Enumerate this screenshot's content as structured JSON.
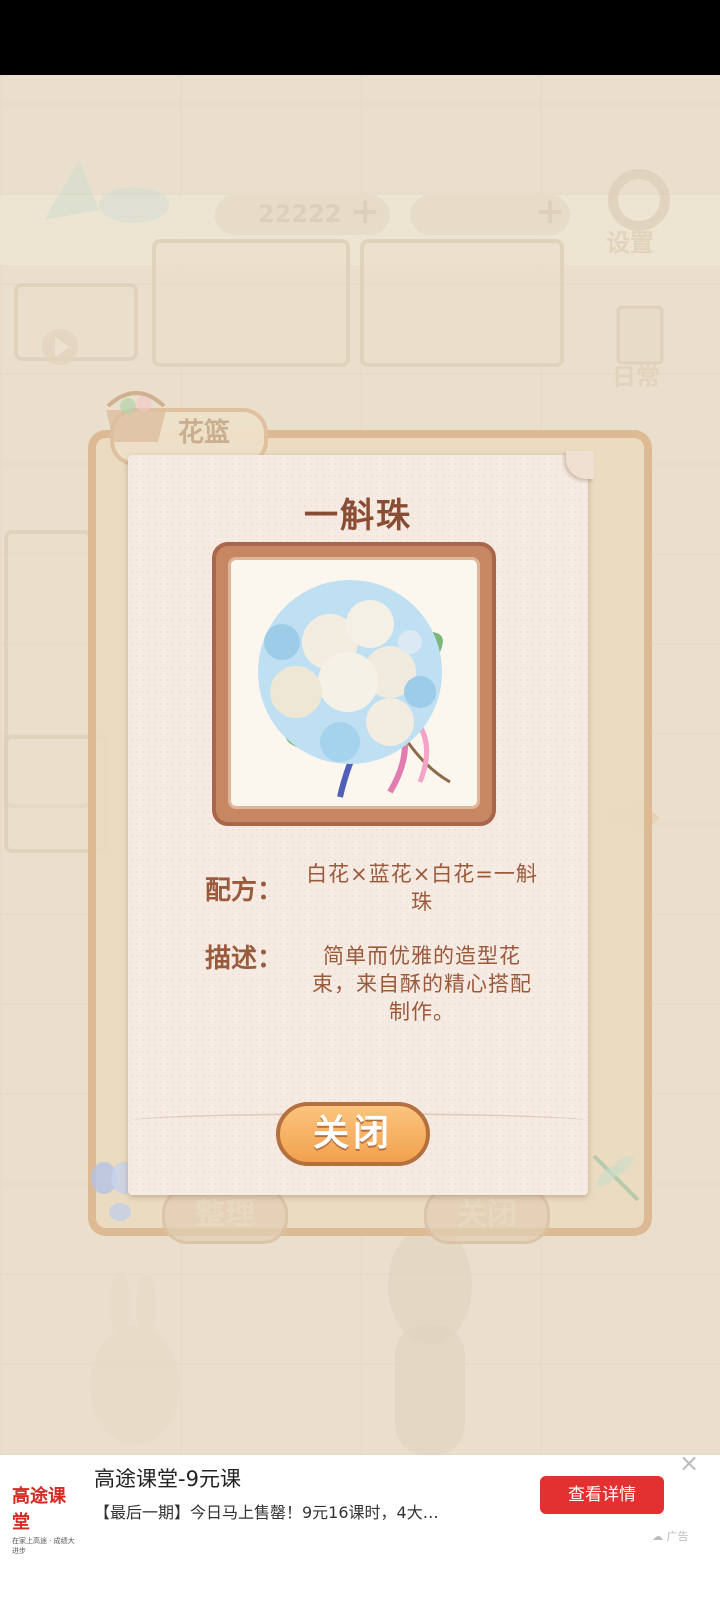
{
  "background_game": {
    "currency_amount": "22222",
    "settings_label": "设置",
    "daily_label": "日常",
    "basket_tab_label": "花篮",
    "sort_button_label": "整理",
    "background_close_label": "关闭"
  },
  "dialog": {
    "title": "一斛珠",
    "recipe_label": "配方：",
    "recipe_value": "白花×蓝花×白花=一斛珠",
    "description_label": "描述：",
    "description_value": "简单而优雅的造型花束，来自酥的精心搭配制作。",
    "close_button_label": "关闭"
  },
  "ad": {
    "logo_text": "高途课堂",
    "logo_sub": "在家上高途 · 成绩大进步",
    "title": "高途课堂-9元课",
    "description": "【最后一期】今日马上售罄！9元16课时，4大…",
    "cta_label": "查看详情",
    "ad_tag": "广告"
  },
  "colors": {
    "accent_orange": "#f2a14e",
    "title_brown": "#8a4d33",
    "ad_red": "#e33131"
  }
}
